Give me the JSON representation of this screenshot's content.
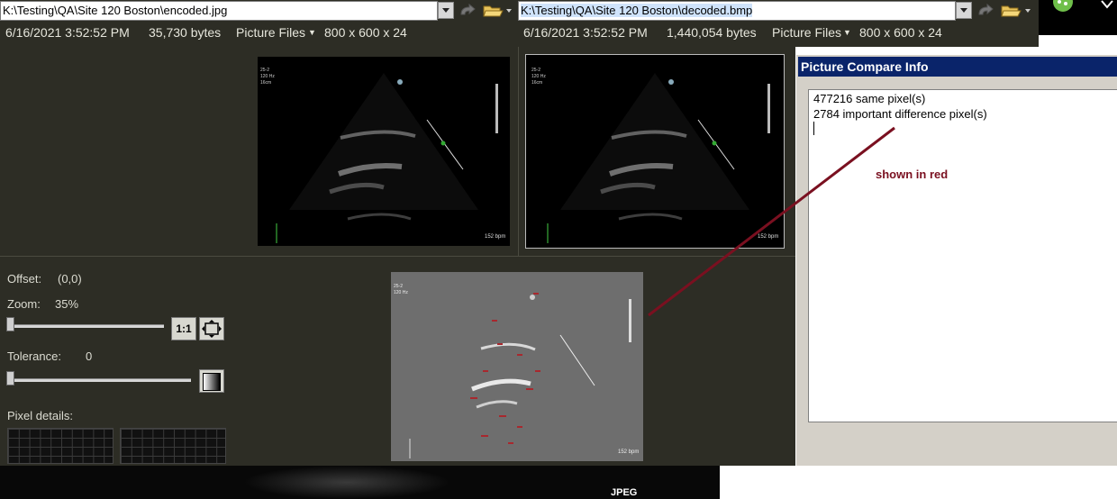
{
  "left_pane": {
    "path": "K:\\Testing\\QA\\Site 120 Boston\\encoded.jpg",
    "date": "6/16/2021 3:52:52 PM",
    "size": "35,730 bytes",
    "filter": "Picture Files",
    "dimensions": "800 x 600 x 24"
  },
  "right_pane": {
    "path": "K:\\Testing\\QA\\Site 120 Boston\\decoded.bmp",
    "date": "6/16/2021 3:52:52 PM",
    "size": "1,440,054 bytes",
    "filter": "Picture Files",
    "dimensions": "800 x 600 x 24"
  },
  "controls": {
    "offset_label": "Offset:",
    "offset_value": "(0,0)",
    "zoom_label": "Zoom:",
    "zoom_value": "35%",
    "one_to_one": "1:1",
    "tolerance_label": "Tolerance:",
    "tolerance_value": "0",
    "pixel_details_label": "Pixel details:"
  },
  "ultrasound": {
    "bpm": "152 bpm"
  },
  "compare_window": {
    "title": "Picture Compare Info",
    "lines": [
      "477216 same pixel(s)",
      "2784 important difference pixel(s)"
    ]
  },
  "annotation": "shown in red",
  "footer_tag": "JPEG",
  "colors": {
    "panel_bg": "#2d2d25",
    "title_bar": "#0a246a",
    "annotation": "#7a1020"
  },
  "icons": [
    "dropdown-arrow-icon",
    "redo-arrow-icon",
    "folder-open-icon",
    "fit-to-window-icon",
    "gradient-icon"
  ]
}
